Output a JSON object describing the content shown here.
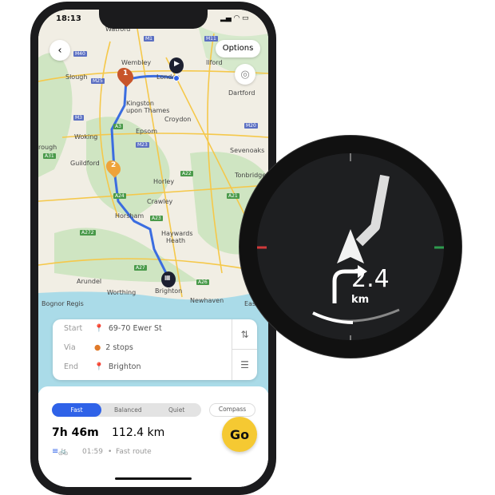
{
  "status": {
    "time": "18:13"
  },
  "map": {
    "back_icon": "chevron-left-icon",
    "options_label": "Options",
    "locate_icon": "crosshair-icon",
    "places": [
      "Watford",
      "Wembley",
      "Slough",
      "London",
      "Ilford",
      "Dartford",
      "Kingston",
      "upon Thames",
      "Croydon",
      "Epsom",
      "Woking",
      "Guildford",
      "Sevenoaks",
      "Tonbridge",
      "Horley",
      "Crawley",
      "Horsham",
      "Haywards",
      "Heath",
      "Arundel",
      "Worthing",
      "Brighton",
      "Newhaven",
      "Bognor Regis",
      "Eastbo",
      "rough"
    ],
    "roads": [
      "M40",
      "M1",
      "M11",
      "M25",
      "M3",
      "M20",
      "M23",
      "A3",
      "A22",
      "A23",
      "A24",
      "A26",
      "A27",
      "A272",
      "A21",
      "A31"
    ],
    "markers": {
      "stop1": "1",
      "stop2": "2"
    },
    "route_color": "#3b6de0"
  },
  "route_card": {
    "start": {
      "label": "Start",
      "value": "69-70 Ewer St"
    },
    "via": {
      "label": "Via",
      "value": "2 stops"
    },
    "end": {
      "label": "End",
      "value": "Brighton"
    },
    "swap_icon": "swap-vertical-icon",
    "add_icon": "add-stop-icon"
  },
  "panel": {
    "modes": [
      "Fast",
      "Balanced",
      "Quiet"
    ],
    "selected_mode": "Fast",
    "compass_label": "Compass",
    "duration": "7h 46m",
    "distance": "112.4 km",
    "eta_time": "01:59",
    "separator": "•",
    "route_type": "Fast route",
    "go_label": "Go",
    "accent": "#2f62e8",
    "go_color": "#f5c932"
  },
  "watch": {
    "distance": "2.4",
    "unit": "km",
    "left_marker_color": "#d13a3a",
    "right_marker_color": "#2e9b4e"
  }
}
